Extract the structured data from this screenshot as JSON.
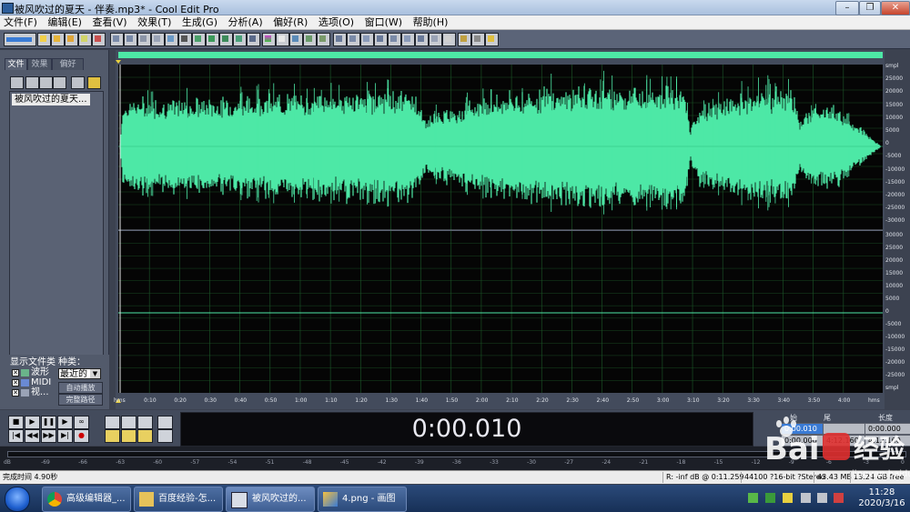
{
  "window": {
    "title": "被风吹过的夏天 - 伴奏.mp3* - Cool Edit Pro",
    "minimize": "–",
    "restore": "❐",
    "close": "✕"
  },
  "menu": [
    "文件(F)",
    "编辑(E)",
    "查看(V)",
    "效果(T)",
    "生成(G)",
    "分析(A)",
    "偏好(R)",
    "选项(O)",
    "窗口(W)",
    "帮助(H)"
  ],
  "left_panel": {
    "tabs": [
      "文件",
      "效果",
      "偏好"
    ],
    "file_item": "被风吹过的夏天...",
    "show_types_label": "显示文件类",
    "sort_label": "种类：",
    "sort_value": "最近的",
    "types": [
      "波形",
      "MIDI",
      "视..."
    ],
    "btn_autoplay": "自动播放",
    "btn_fullpath": "完整路径"
  },
  "waveform": {
    "amp_top": [
      "smpl",
      "25000",
      "20000",
      "15000",
      "10000",
      "5000",
      "0",
      "-5000",
      "-10000",
      "-15000",
      "-20000",
      "-25000",
      "-30000"
    ],
    "amp_bottom": [
      "30000",
      "25000",
      "20000",
      "15000",
      "10000",
      "5000",
      "0",
      "-5000",
      "-10000",
      "-15000",
      "-20000",
      "-25000",
      "smpl"
    ],
    "time_ticks": [
      "hms",
      "0:10",
      "0:20",
      "0:30",
      "0:40",
      "0:50",
      "1:00",
      "1:10",
      "1:20",
      "1:30",
      "1:40",
      "1:50",
      "2:00",
      "2:10",
      "2:20",
      "2:30",
      "2:40",
      "2:50",
      "3:00",
      "3:10",
      "3:20",
      "3:30",
      "3:40",
      "3:50",
      "4:00",
      "hms"
    ],
    "wave_color": "#4de8a6",
    "background": "#050505",
    "grid_color": "#1d5a2a"
  },
  "transport": {
    "time": "0:00.010",
    "selection": {
      "headers": [
        "始",
        "尾",
        "长度"
      ],
      "sel_begin": "0:00.010",
      "sel_end": "",
      "sel_length": "0:00.000",
      "view_begin": "0:00.000",
      "view_end": "4:12.160",
      "view_length": "4:12.160"
    }
  },
  "meter_ticks": [
    "dB",
    "-69",
    "-66",
    "-63",
    "-60",
    "-57",
    "-54",
    "-51",
    "-48",
    "-45",
    "-42",
    "-39",
    "-36",
    "-33",
    "-30",
    "-27",
    "-24",
    "-21",
    "-18",
    "-15",
    "-12",
    "-9",
    "-6",
    "-3",
    "0"
  ],
  "status": {
    "message": "完成时间 4.90秒",
    "level": "R: -inf dB @  0:11.259",
    "format": "44100 ?16-bit ?Stereo",
    "size": "43.43 MB",
    "free": "13.24 GB free"
  },
  "taskbar": {
    "tasks": [
      "高级编辑器_...",
      "百度经验-怎...",
      "被风吹过的...",
      "4.png - 画图"
    ],
    "clock_time": "11:28",
    "clock_date": "2020/3/16"
  },
  "watermark": {
    "brand": "Bai",
    "brand2": "经验",
    "url": "jingyan.baidu.com"
  }
}
